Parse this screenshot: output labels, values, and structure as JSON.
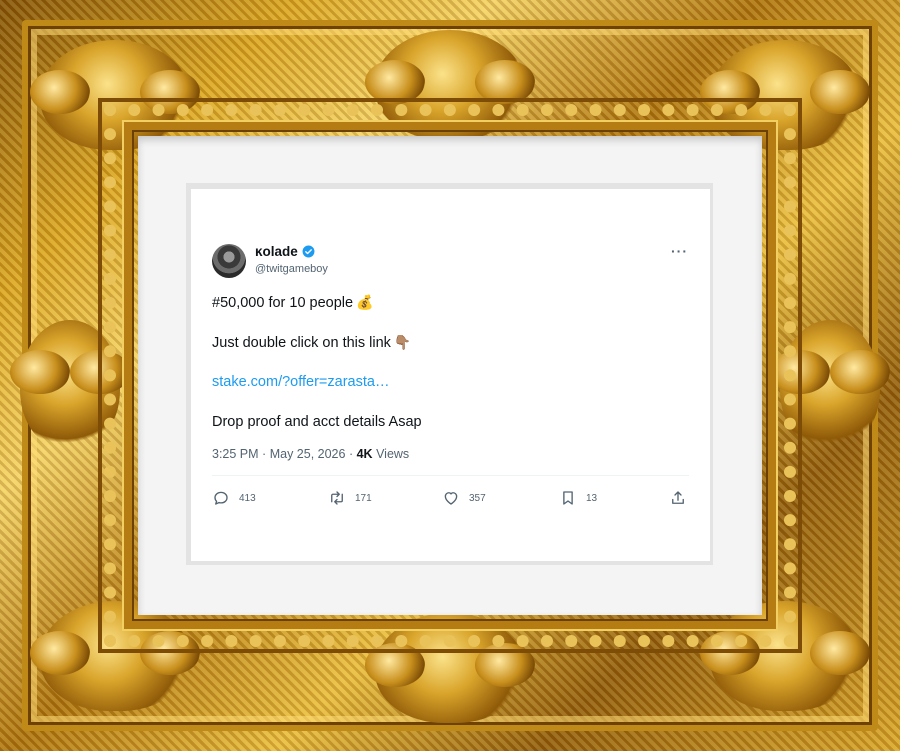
{
  "tweet": {
    "display_name": "ĸolade",
    "handle": "@twitgameboy",
    "verified": true,
    "more_icon": "more-horizontal-icon",
    "lines": [
      "#50,000 for 10 people",
      "Just double click on this link",
      "stake.com/?offer=zarasta…",
      "Drop proof and acct details Asap"
    ],
    "emoji_money_bag": "💰",
    "emoji_point_down": "👇🏽",
    "time": "3:25 PM",
    "date": "May 25, 2026",
    "views_count": "4K",
    "views_label": "Views",
    "sep": "·",
    "actions": {
      "replies": "413",
      "retweets": "171",
      "likes": "357",
      "bookmarks": "13"
    }
  },
  "colors": {
    "link": "#1d9bf0",
    "verified": "#1d9bf0",
    "text": "#0f1419",
    "muted": "#536471",
    "frame_gold": "#d9a521"
  }
}
